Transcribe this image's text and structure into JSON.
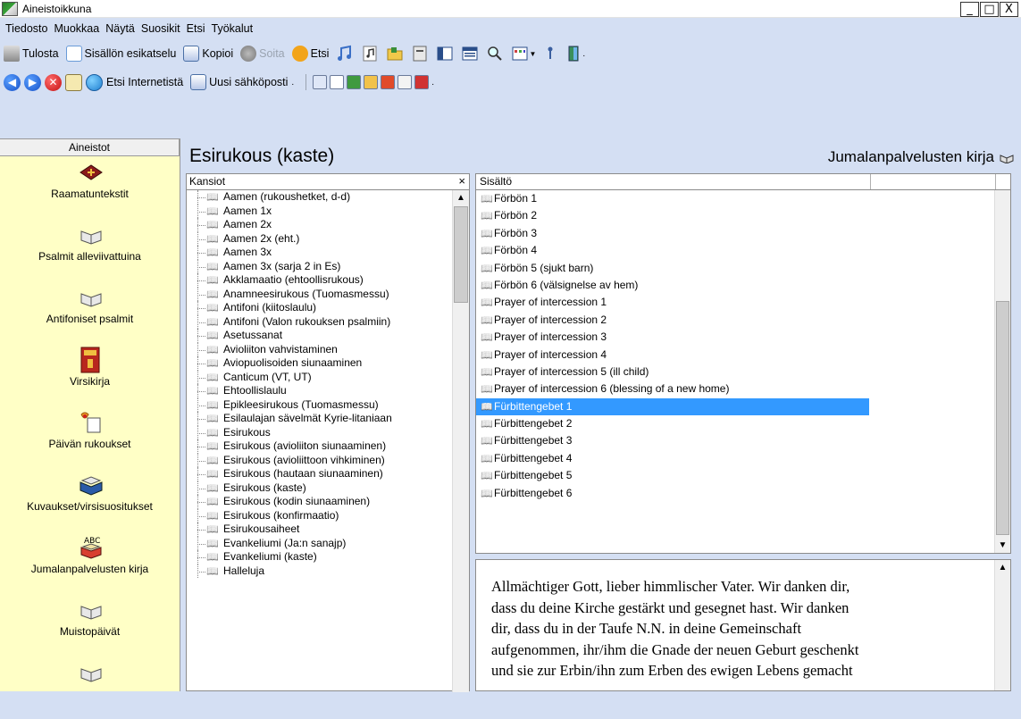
{
  "window": {
    "title": "Aineistoikkuna",
    "minimize": "_",
    "maximize": "□",
    "close": "X"
  },
  "menu": [
    "Tiedosto",
    "Muokkaa",
    "Näytä",
    "Suosikit",
    "Etsi",
    "Työkalut"
  ],
  "toolbar1": {
    "print": "Tulosta",
    "preview": "Sisällön esikatselu",
    "copy": "Kopioi",
    "play": "Soita",
    "find": "Etsi"
  },
  "toolbar2": {
    "search_internet": "Etsi Internetistä",
    "new_email": "Uusi sähköposti"
  },
  "sidebar": {
    "header": "Aineistot",
    "items": [
      {
        "label": "Raamatuntekstit",
        "icon": "bible-icon"
      },
      {
        "label": "Psalmit alleviivattuina",
        "icon": "open-book-icon"
      },
      {
        "label": "Antifoniset psalmit",
        "icon": "open-book-icon"
      },
      {
        "label": "Virsikirja",
        "icon": "hymnal-icon"
      },
      {
        "label": "Päivän rukoukset",
        "icon": "prayer-icon"
      },
      {
        "label": "Kuvaukset/virsisuositukset",
        "icon": "blue-book-icon"
      },
      {
        "label": "Jumalanpalvelusten kirja",
        "icon": "abc-book-icon"
      },
      {
        "label": "Muistopäivät",
        "icon": "open-book-icon"
      }
    ]
  },
  "main": {
    "title": "Esirukous (kaste)",
    "book": "Jumalanpalvelusten kirja"
  },
  "folders": {
    "header": "Kansiot",
    "close": "×",
    "items": [
      "Aamen (rukoushetket, d-d)",
      "Aamen 1x",
      "Aamen 2x",
      "Aamen 2x (eht.)",
      "Aamen 3x",
      "Aamen 3x (sarja 2 in Es)",
      "Akklamaatio (ehtoollisrukous)",
      "Anamneesirukous (Tuomasmessu)",
      "Antifoni (kiitoslaulu)",
      "Antifoni (Valon rukouksen psalmiin)",
      "Asetussanat",
      "Avioliiton vahvistaminen",
      "Aviopuolisoiden siunaaminen",
      "Canticum (VT, UT)",
      "Ehtoollislaulu",
      "Epikleesirukous (Tuomasmessu)",
      "Esilaulajan sävelmät Kyrie-litaniaan",
      "Esirukous",
      "Esirukous (avioliiton siunaaminen)",
      "Esirukous (avioliittoon vihkiminen)",
      "Esirukous (hautaan siunaaminen)",
      "Esirukous (kaste)",
      "Esirukous (kodin siunaaminen)",
      "Esirukous (konfirmaatio)",
      "Esirukousaiheet",
      "Evankeliumi (Ja:n sanajp)",
      "Evankeliumi (kaste)",
      "Halleluja"
    ],
    "current_index": 21
  },
  "contents": {
    "header": "Sisältö",
    "items": [
      "Förbön 1",
      "Förbön 2",
      "Förbön 3",
      "Förbön 4",
      "Förbön 5 (sjukt barn)",
      "Förbön 6 (välsignelse av hem)",
      "Prayer of intercession 1",
      "Prayer of intercession 2",
      "Prayer of intercession 3",
      "Prayer of intercession 4",
      "Prayer of intercession 5 (ill child)",
      "Prayer of intercession 6 (blessing of a new home)",
      "Fürbittengebet 1",
      "Fürbittengebet 2",
      "Fürbittengebet 3",
      "Fürbittengebet 4",
      "Fürbittengebet 5",
      "Fürbittengebet 6"
    ],
    "selected_index": 12
  },
  "text": {
    "lines": [
      "Allmächtiger Gott, lieber himmlischer Vater. Wir danken dir,",
      "dass du deine Kirche gestärkt und gesegnet hast. Wir danken",
      "dir, dass du in der Taufe N.N. in deine Gemeinschaft",
      "aufgenommen, ihr/ihm die Gnade der neuen Geburt geschenkt",
      "und sie zur Erbin/ihn zum Erben des ewigen Lebens gemacht"
    ]
  },
  "colors": {
    "chrome": "#d4dff3",
    "sidebar": "#ffffc6",
    "selection": "#3399ff"
  }
}
